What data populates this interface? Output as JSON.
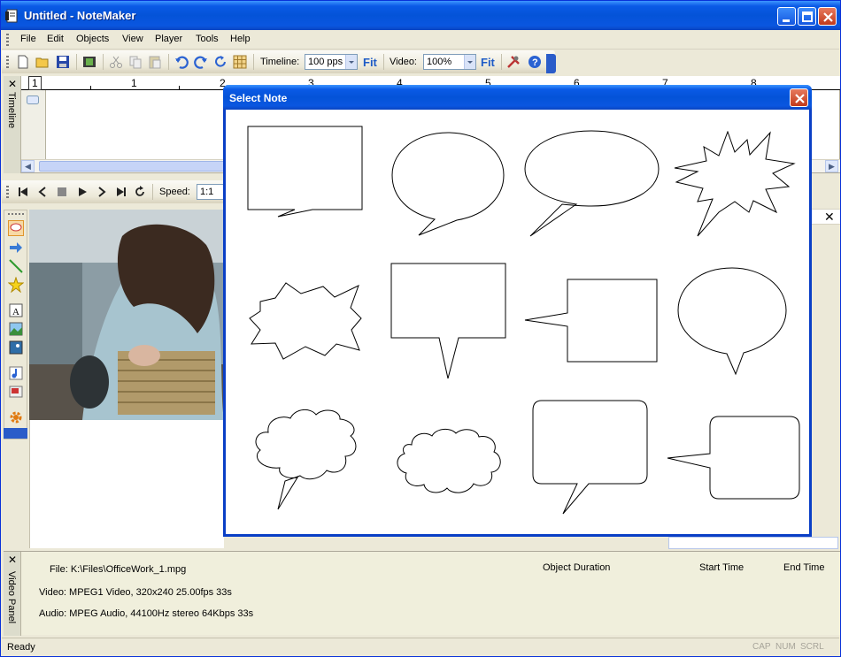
{
  "window": {
    "title": "Untitled - NoteMaker"
  },
  "menu": {
    "items": [
      {
        "label": "File"
      },
      {
        "label": "Edit"
      },
      {
        "label": "Objects"
      },
      {
        "label": "View"
      },
      {
        "label": "Player"
      },
      {
        "label": "Tools"
      },
      {
        "label": "Help"
      }
    ]
  },
  "toolbar": {
    "timeline_label": "Timeline:",
    "timeline_value": "100 pps",
    "video_label": "Video:",
    "video_value": "100%",
    "fit_label": "Fit"
  },
  "timeline": {
    "caption": "Timeline",
    "track_number": "1",
    "ruler": [
      "1",
      "2",
      "3",
      "4",
      "5",
      "6",
      "7",
      "8"
    ]
  },
  "player": {
    "speed_label": "Speed:",
    "speed_value": "1:1"
  },
  "dialog": {
    "title": "Select Note",
    "shapes": [
      "rectangle-callout",
      "oval-callout",
      "wide-oval-callout",
      "spiky-callout",
      "explosion-shape",
      "rectangle-down-callout",
      "rectangle-left-callout",
      "oval-down-callout",
      "cloud-callout",
      "cloud-shape",
      "rounded-rectangle-callout",
      "rounded-rectangle-left-callout"
    ]
  },
  "video_panel": {
    "caption": "Video Panel",
    "file": "File: K:\\Files\\OfficeWork_1.mpg",
    "video": "Video: MPEG1 Video, 320x240 25.00fps 33s",
    "audio": "Audio: MPEG Audio, 44100Hz stereo 64Kbps 33s",
    "columns": [
      "Object Duration",
      "Start Time",
      "End Time"
    ]
  },
  "status": {
    "text": "Ready",
    "indicators": [
      "CAP",
      "NUM",
      "SCRL"
    ]
  }
}
